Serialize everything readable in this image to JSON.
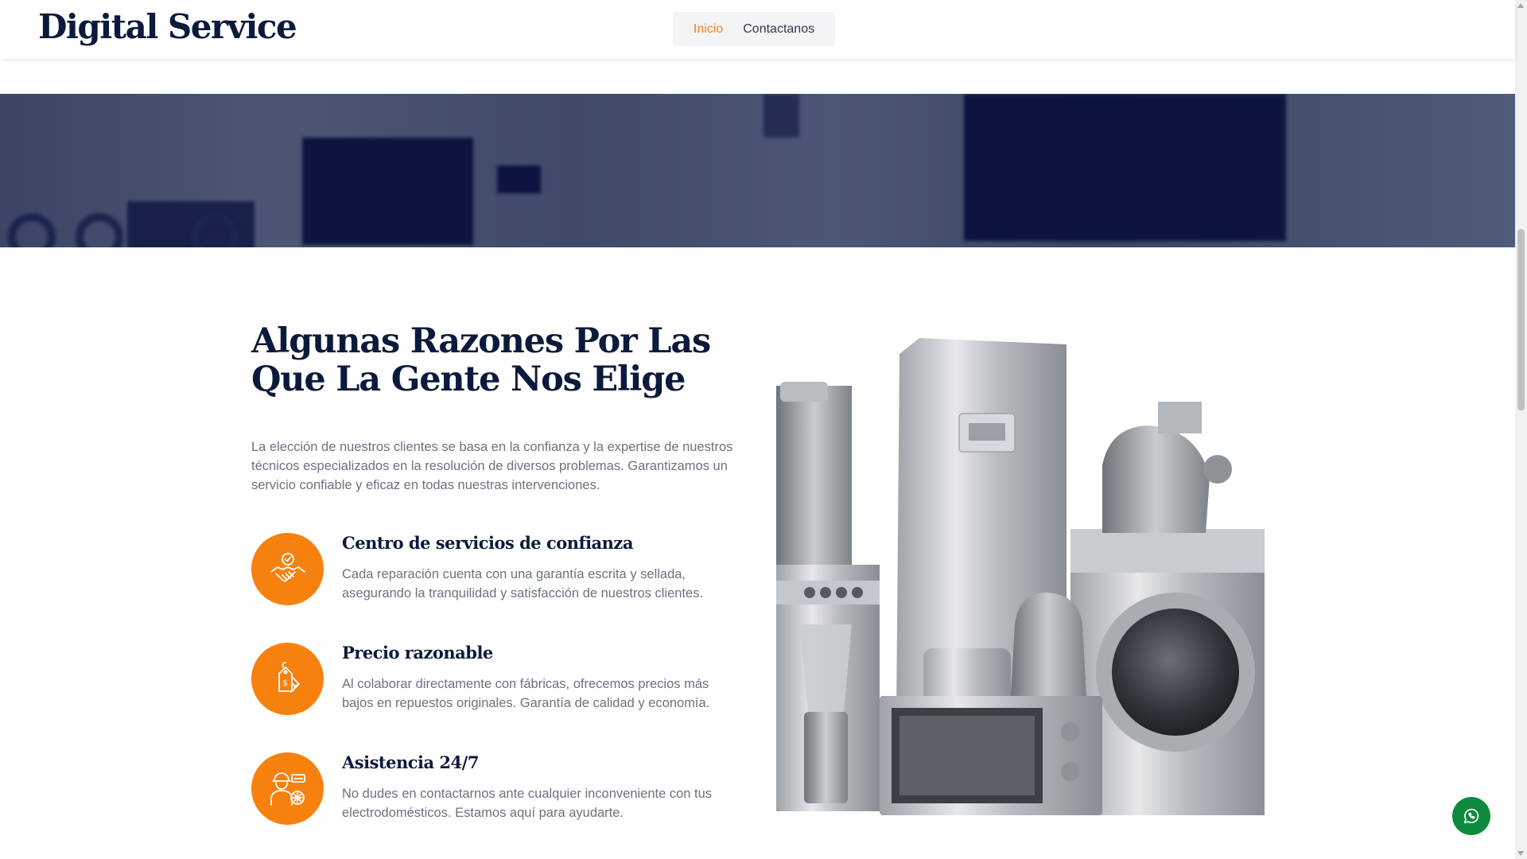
{
  "header": {
    "brand": "Digital Service",
    "nav": [
      {
        "label": "Inicio",
        "active": true
      },
      {
        "label": "Contactanos",
        "active": false
      }
    ]
  },
  "section": {
    "title": "Algunas Razones Por Las Que La Gente Nos Elige",
    "intro": "La elección de nuestros clientes se basa en la confianza y la expertise de nuestros técnicos especializados en la resolución de diversos problemas. Garantizamos un servicio confiable y eficaz en todas nuestras intervenciones.",
    "features": [
      {
        "icon": "handshake-check-icon",
        "title": "Centro de servicios de confianza",
        "description": "Cada reparación cuenta con una garantía escrita y sellada, asegurando la tranquilidad y satisfacción de nuestros clientes."
      },
      {
        "icon": "price-tag-icon",
        "title": "Precio razonable",
        "description": "Al colaborar directamente con fábricas, ofrecemos precios más bajos en repuestos originales. Garantía de calidad y economía."
      },
      {
        "icon": "technician-icon",
        "title": "Asistencia 24/7",
        "description": "No dudes en contactarnos ante cualquier inconveniente con tus electrodomésticos. Estamos aquí para ayudarte."
      }
    ]
  },
  "colors": {
    "accent": "#f7810f",
    "heading": "#0b1a3c",
    "text": "#6b7280",
    "whatsapp": "#0e8a3f",
    "hero": "#3b4566"
  }
}
